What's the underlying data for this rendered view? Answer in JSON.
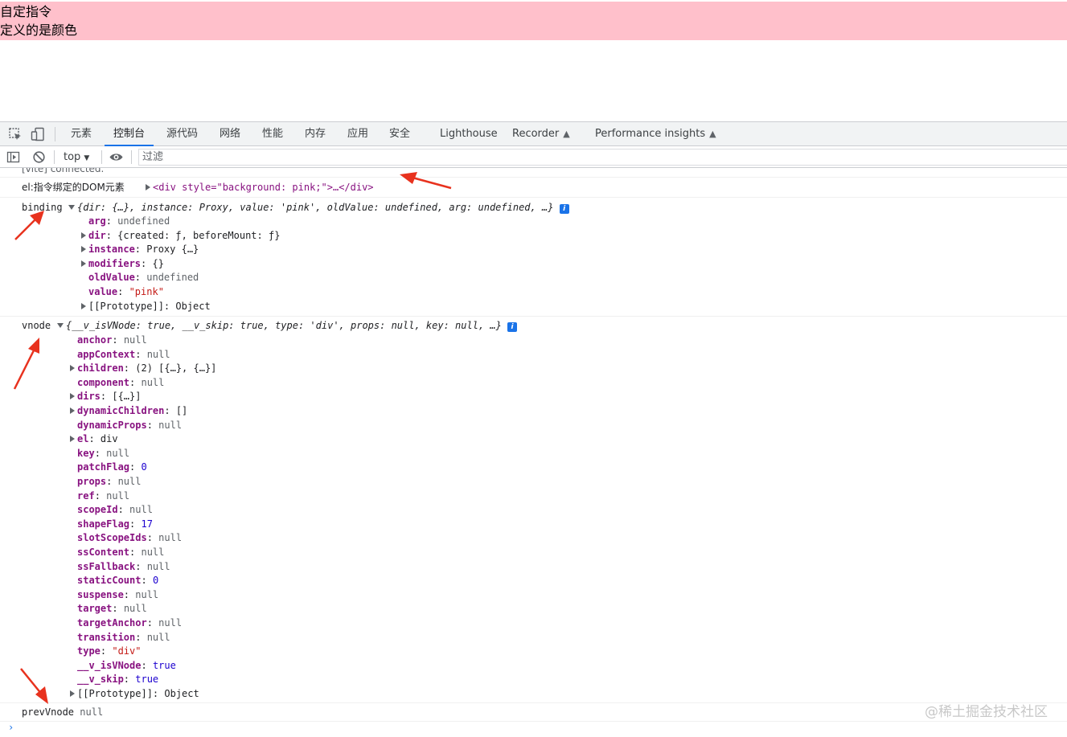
{
  "page": {
    "line1": "自定指令",
    "line2": "定义的是颜色"
  },
  "devtools": {
    "tabs": [
      "元素",
      "控制台",
      "源代码",
      "网络",
      "性能",
      "内存",
      "应用",
      "安全",
      "Lighthouse",
      "Recorder",
      "Performance insights"
    ],
    "active_tab": "控制台",
    "context_label": "top",
    "filter_placeholder": "过滤"
  },
  "console": {
    "vite_line": "[vite] connected.",
    "el_label": "el:指令绑定的DOM元素",
    "el_value": "<div style=\"background: pink;\">…</div>",
    "binding_label": "binding",
    "binding_summary": "{dir: {…}, instance: Proxy, value: 'pink', oldValue: undefined, arg: undefined, …}",
    "binding_props": [
      {
        "key": "arg",
        "value": "undefined",
        "expandable": false
      },
      {
        "key": "dir",
        "value": "{created: ƒ, beforeMount: ƒ}",
        "expandable": true
      },
      {
        "key": "instance",
        "value": "Proxy {…}",
        "expandable": true
      },
      {
        "key": "modifiers",
        "value": "{}",
        "expandable": true
      },
      {
        "key": "oldValue",
        "value": "undefined",
        "expandable": false
      },
      {
        "key": "value",
        "value": "\"pink\"",
        "expandable": false
      },
      {
        "key": "[[Prototype]]",
        "value": "Object",
        "expandable": true
      }
    ],
    "vnode_label": "vnode",
    "vnode_summary": "{__v_isVNode: true, __v_skip: true, type: 'div', props: null, key: null, …}",
    "vnode_props": [
      {
        "key": "anchor",
        "value": "null",
        "expandable": false
      },
      {
        "key": "appContext",
        "value": "null",
        "expandable": false
      },
      {
        "key": "children",
        "value": "(2) [{…}, {…}]",
        "expandable": true
      },
      {
        "key": "component",
        "value": "null",
        "expandable": false
      },
      {
        "key": "dirs",
        "value": "[{…}]",
        "expandable": true
      },
      {
        "key": "dynamicChildren",
        "value": "[]",
        "expandable": true
      },
      {
        "key": "dynamicProps",
        "value": "null",
        "expandable": false
      },
      {
        "key": "el",
        "value": "div",
        "expandable": true
      },
      {
        "key": "key",
        "value": "null",
        "expandable": false
      },
      {
        "key": "patchFlag",
        "value": "0",
        "expandable": false
      },
      {
        "key": "props",
        "value": "null",
        "expandable": false
      },
      {
        "key": "ref",
        "value": "null",
        "expandable": false
      },
      {
        "key": "scopeId",
        "value": "null",
        "expandable": false
      },
      {
        "key": "shapeFlag",
        "value": "17",
        "expandable": false
      },
      {
        "key": "slotScopeIds",
        "value": "null",
        "expandable": false
      },
      {
        "key": "ssContent",
        "value": "null",
        "expandable": false
      },
      {
        "key": "ssFallback",
        "value": "null",
        "expandable": false
      },
      {
        "key": "staticCount",
        "value": "0",
        "expandable": false
      },
      {
        "key": "suspense",
        "value": "null",
        "expandable": false
      },
      {
        "key": "target",
        "value": "null",
        "expandable": false
      },
      {
        "key": "targetAnchor",
        "value": "null",
        "expandable": false
      },
      {
        "key": "transition",
        "value": "null",
        "expandable": false
      },
      {
        "key": "type",
        "value": "\"div\"",
        "expandable": false
      },
      {
        "key": "__v_isVNode",
        "value": "true",
        "expandable": false
      },
      {
        "key": "__v_skip",
        "value": "true",
        "expandable": false
      },
      {
        "key": "[[Prototype]]",
        "value": "Object",
        "expandable": true
      }
    ],
    "prevvnode_label": "prevVnode",
    "prevvnode_value": "null"
  },
  "watermark": "@稀土掘金技术社区",
  "colors": {
    "page_bg": "#ffc0cb",
    "accent": "#1a73e8",
    "arrow": "#e8321e"
  }
}
